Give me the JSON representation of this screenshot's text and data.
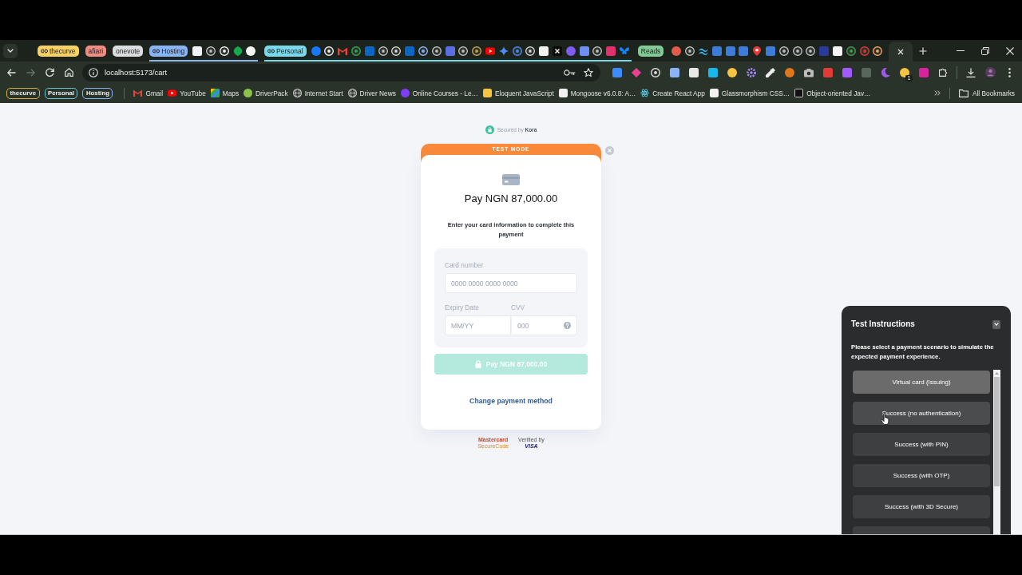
{
  "browser": {
    "tab_groups": [
      {
        "label": "thecurve",
        "color": "#fad165",
        "linked": true
      },
      {
        "label": "afiari",
        "color": "#f28b82",
        "linked": false
      },
      {
        "label": "onevote",
        "color": "#dadce0",
        "linked": false
      },
      {
        "label": "Hosting",
        "color": "#8ab4f8",
        "linked": true,
        "tabs": [
          {
            "selected": false
          },
          {
            "selected": false
          },
          {
            "selected": false
          },
          {
            "selected": false
          },
          {
            "selected": false
          }
        ]
      },
      {
        "label": "Personal",
        "color": "#78d9ec",
        "linked": true,
        "tabs": [
          {
            "selected": false
          },
          {
            "selected": false
          },
          {
            "selected": false
          },
          {
            "selected": false
          },
          {
            "selected": false
          },
          {
            "selected": false
          },
          {
            "selected": false
          },
          {
            "selected": false
          },
          {
            "selected": false
          },
          {
            "selected": false
          },
          {
            "selected": false
          },
          {
            "selected": false
          },
          {
            "selected": false
          },
          {
            "selected": false
          },
          {
            "selected": false
          },
          {
            "selected": false
          },
          {
            "selected": false
          },
          {
            "selected": false
          },
          {
            "selected": false
          },
          {
            "selected": false
          },
          {
            "selected": false
          },
          {
            "selected": false
          },
          {
            "selected": false
          },
          {
            "selected": false
          }
        ]
      },
      {
        "label": "Reads",
        "color": "#81c995",
        "linked": false
      }
    ],
    "tabs": [
      {
        "selected": false
      },
      {
        "selected": false
      },
      {
        "selected": false
      },
      {
        "selected": false
      },
      {
        "selected": false
      },
      {
        "selected": false
      },
      {
        "selected": false
      },
      {
        "selected": false
      },
      {
        "selected": false
      },
      {
        "selected": false
      },
      {
        "selected": false
      },
      {
        "selected": false
      },
      {
        "selected": false
      },
      {
        "selected": false
      },
      {
        "selected": false
      },
      {
        "selected": false
      },
      {
        "selected": true
      }
    ],
    "toolbar": {
      "nav_buttons": [
        {
          "kind": "back",
          "disabled": false
        },
        {
          "kind": "forward",
          "disabled": true
        },
        {
          "kind": "reload",
          "disabled": false
        },
        {
          "kind": "home",
          "disabled": false
        }
      ],
      "url": "localhost:5173/cart",
      "extension_badge": "1"
    },
    "bookmark_groups": [
      {
        "label": "thecurve",
        "color": "#d8b04a"
      },
      {
        "label": "Personal",
        "color": "#6cc6d8"
      },
      {
        "label": "Hosting",
        "color": "#8ab4f8"
      }
    ],
    "bookmarks": [
      "Gmail",
      "YouTube",
      "Maps",
      "DriverPack",
      "Internet Start",
      "Driver News",
      "Online Courses - Le…",
      "Eloquent JavaScript",
      "Mongoose v6.0.8: A…",
      "Create React App",
      "Glassmorphism CSS…",
      "Object-oriented Jav…"
    ],
    "all_bookmarks": "All Bookmarks"
  },
  "page": {
    "secured_by": "Secured by **Kora**",
    "checkout": {
      "mode_banner": "TEST MODE",
      "amount_title": "Pay NGN 87,000.00",
      "instruction": "Enter your card information to complete this payment",
      "card_number": {
        "label": "Card number",
        "placeholder": "0000 0000 0000 0000"
      },
      "expiry": {
        "label": "Expiry Date",
        "placeholder": "MM/YY"
      },
      "cvv": {
        "label": "CVV",
        "placeholder": "000"
      },
      "pay_button": {
        "label": "Pay NGN 87,000.00",
        "disabled": true
      },
      "change_method": "Change payment method"
    },
    "trust_badges": [
      {
        "kind": "mastercard",
        "lines": [
          "Mastercard",
          "SecureCode"
        ]
      },
      {
        "kind": "visa",
        "lines": [
          "Verified by",
          "VISA"
        ]
      }
    ],
    "test_panel": {
      "title": "Test Instructions",
      "description": "Please select a payment scenario to simulate the expected payment experience.",
      "scenarios": [
        {
          "label": "Virtual card (Issuing)",
          "selected": true,
          "hovered": false
        },
        {
          "label": "Success (no authentication)",
          "selected": false,
          "hovered": true
        },
        {
          "label": "Success (with PIN)",
          "selected": false,
          "hovered": false
        },
        {
          "label": "Success (with OTP)",
          "selected": false,
          "hovered": false
        },
        {
          "label": "Success (with 3D Secure)",
          "selected": false,
          "hovered": false
        },
        {
          "selected": false,
          "hovered": false
        }
      ]
    }
  }
}
